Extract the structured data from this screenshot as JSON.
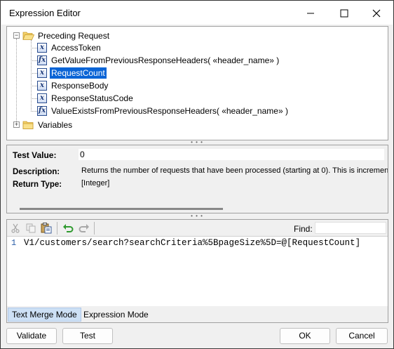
{
  "window": {
    "title": "Expression Editor"
  },
  "tree": {
    "root": {
      "label": "Preceding Request",
      "expander": "−"
    },
    "items": [
      {
        "label": "AccessToken",
        "icon": "x"
      },
      {
        "label": "GetValueFromPreviousResponseHeaders( «header_name» )",
        "icon": "fx"
      },
      {
        "label": "RequestCount",
        "icon": "x",
        "selected": true
      },
      {
        "label": "ResponseBody",
        "icon": "x"
      },
      {
        "label": "ResponseStatusCode",
        "icon": "x"
      },
      {
        "label": "ValueExistsFromPreviousResponseHeaders( «header_name» )",
        "icon": "fx"
      }
    ],
    "second_root": {
      "label": "Variables",
      "expander": "+"
    }
  },
  "details": {
    "test_value_label": "Test Value:",
    "test_value": "0",
    "description_label": "Description:",
    "description": "Returns the number of requests that have been processed (starting at 0). This is incremented",
    "return_type_label": "Return Type:",
    "return_type": "[Integer]"
  },
  "editor": {
    "find_label": "Find:",
    "find_value": "",
    "line_number": "1",
    "code": "V1/customers/search?searchCriteria%5BpageSize%5D=@[RequestCount]",
    "modes": [
      "Text Merge Mode",
      "Expression Mode"
    ],
    "active_mode": "Text Merge Mode"
  },
  "buttons": {
    "validate": "Validate",
    "test": "Test",
    "ok": "OK",
    "cancel": "Cancel"
  },
  "splitter_glyph": "• • •",
  "colors": {
    "selection": "#0a64d6",
    "active_mode_tab": "#cde0f5"
  }
}
